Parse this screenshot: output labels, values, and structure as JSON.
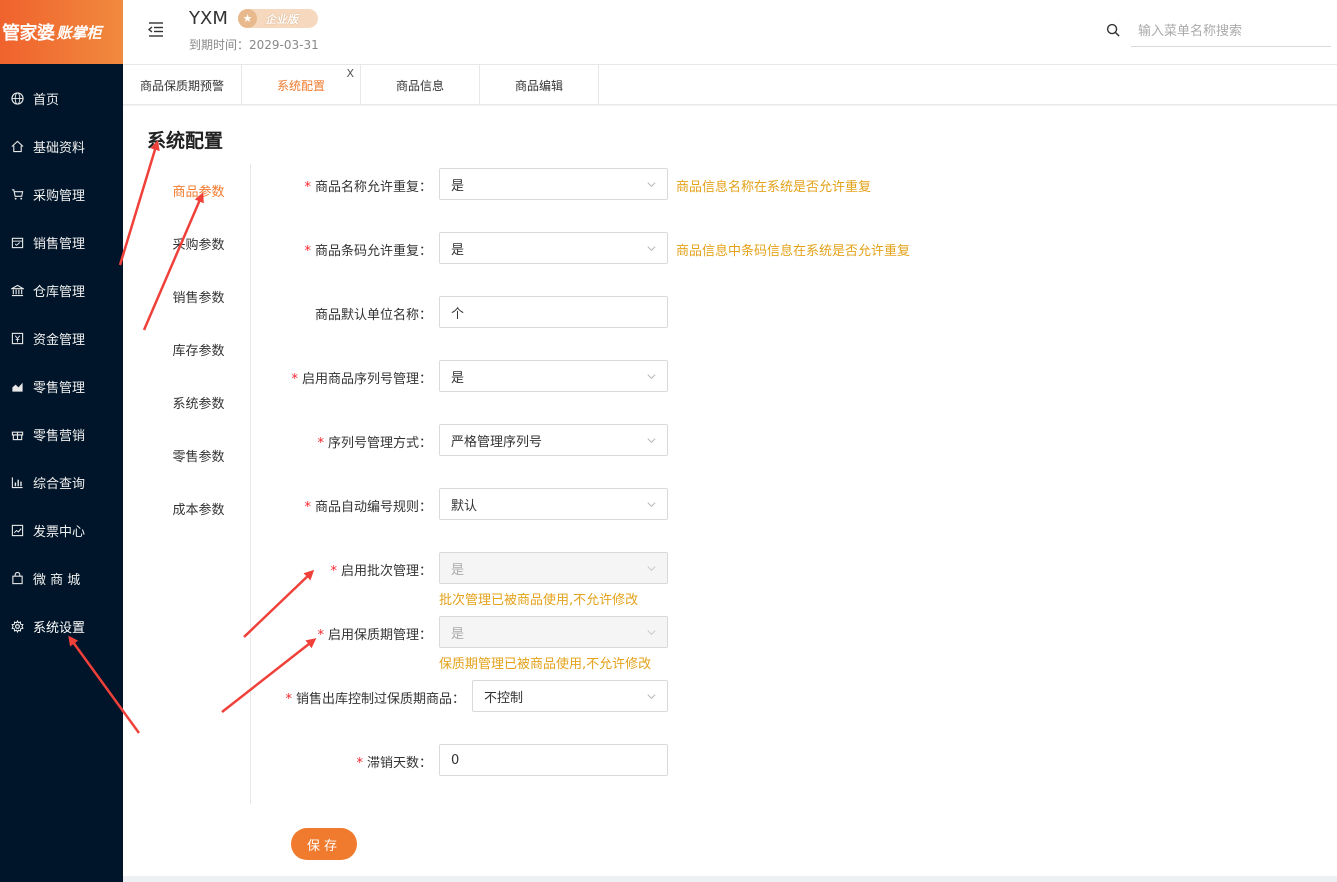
{
  "logo": {
    "main": "管家婆",
    "sub": "账掌柜"
  },
  "sidebar": {
    "items": [
      {
        "label": "首页",
        "icon": "globe-icon"
      },
      {
        "label": "基础资料",
        "icon": "home-icon"
      },
      {
        "label": "采购管理",
        "icon": "cart-icon"
      },
      {
        "label": "销售管理",
        "icon": "calendar-icon"
      },
      {
        "label": "仓库管理",
        "icon": "bank-icon"
      },
      {
        "label": "资金管理",
        "icon": "yen-icon"
      },
      {
        "label": "零售管理",
        "icon": "area-chart-icon"
      },
      {
        "label": "零售营销",
        "icon": "gift-icon"
      },
      {
        "label": "综合查询",
        "icon": "bar-chart-icon"
      },
      {
        "label": "发票中心",
        "icon": "line-chart-icon"
      },
      {
        "label": "微 商 城",
        "icon": "bag-icon"
      },
      {
        "label": "系统设置",
        "icon": "gear-icon"
      }
    ]
  },
  "header": {
    "company": "YXM",
    "edition": "企业版",
    "expire": "到期时间：2029-03-31",
    "search_placeholder": "输入菜单名称搜索"
  },
  "tabs": [
    {
      "label": "商品保质期预警"
    },
    {
      "label": "系统配置",
      "close": "X"
    },
    {
      "label": "商品信息"
    },
    {
      "label": "商品编辑"
    }
  ],
  "page": {
    "title": "系统配置",
    "subnav": [
      "商品参数",
      "采购参数",
      "销售参数",
      "库存参数",
      "系统参数",
      "零售参数",
      "成本参数"
    ],
    "required_mark": "*",
    "fields": [
      {
        "label": "商品名称允许重复",
        "value": "是",
        "hint": "商品信息名称在系统是否允许重复"
      },
      {
        "label": "商品条码允许重复",
        "value": "是",
        "hint": "商品信息中条码信息在系统是否允许重复"
      },
      {
        "label": "商品默认单位名称",
        "value": "个"
      },
      {
        "label": "启用商品序列号管理",
        "value": "是"
      },
      {
        "label": "序列号管理方式",
        "value": "严格管理序列号"
      },
      {
        "label": "商品自动编号规则",
        "value": "默认"
      },
      {
        "label": "启用批次管理",
        "value": "是",
        "hint": "批次管理已被商品使用,不允许修改"
      },
      {
        "label": "启用保质期管理",
        "value": "是",
        "hint": "保质期管理已被商品使用,不允许修改"
      },
      {
        "label": "销售出库控制过保质期商品",
        "value": "不控制"
      },
      {
        "label": "滞销天数",
        "value": "0"
      }
    ],
    "save_label": "保存"
  },
  "colors": {
    "accent": "#f07a2e",
    "sidebar": "#001529",
    "hint": "#e3a21a",
    "arrow": "#f0403a"
  }
}
